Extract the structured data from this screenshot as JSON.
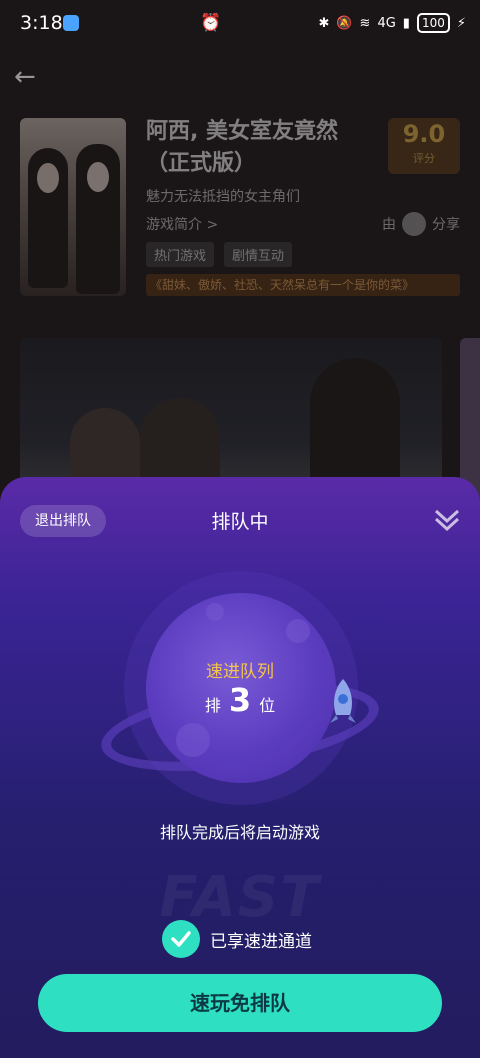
{
  "status": {
    "time": "3:18",
    "network": "4G",
    "battery": "100"
  },
  "game": {
    "title": "阿西, 美女室友竟然（正式版）",
    "subtitle": "魅力无法抵挡的女主角们",
    "intro_link": "游戏简介 >",
    "score": "9.0",
    "score_label": "评分",
    "author_prefix": "由",
    "share_label": "分享",
    "tags": [
      "热门游戏",
      "剧情互动"
    ],
    "slogan": "《甜妹、傲娇、社恐、天然呆总有一个是你的菜》"
  },
  "queue": {
    "exit_label": "退出排队",
    "title": "排队中",
    "queue_name": "速进队列",
    "rank_prefix": "排",
    "rank_number": "3",
    "rank_suffix": "位",
    "hint": "排队完成后将启动游戏",
    "fast_channel_label": "已享速进通道",
    "cta_label": "速玩免排队",
    "bg_watermark": "FAST"
  },
  "colors": {
    "accent": "#2ee0c1",
    "gold": "#f5c44c",
    "sheet_top": "#5a2aa8",
    "sheet_bottom": "#231c5e"
  }
}
